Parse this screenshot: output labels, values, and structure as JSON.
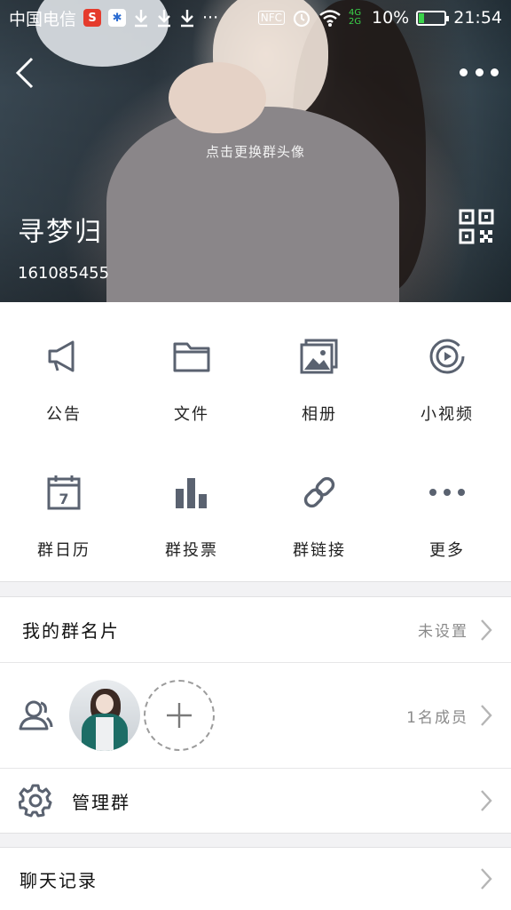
{
  "status_bar": {
    "carrier": "中国电信",
    "app_badge_1": "S",
    "app_badge_2": "✱",
    "download_icons": [
      "download-icon",
      "download-icon",
      "download-icon"
    ],
    "more_dots": "···",
    "nfc": "NFC",
    "network": "4G 2G",
    "battery_percent": "10%",
    "time": "21:54"
  },
  "header": {
    "avatar_hint": "点击更换群头像",
    "group_name": "寻梦归",
    "group_id": "161085455"
  },
  "features": [
    {
      "label": "公告",
      "icon": "megaphone-icon"
    },
    {
      "label": "文件",
      "icon": "folder-icon"
    },
    {
      "label": "相册",
      "icon": "album-icon"
    },
    {
      "label": "小视频",
      "icon": "video-icon"
    },
    {
      "label": "群日历",
      "icon": "calendar-icon"
    },
    {
      "label": "群投票",
      "icon": "poll-icon"
    },
    {
      "label": "群链接",
      "icon": "link-icon"
    },
    {
      "label": "更多",
      "icon": "more-icon"
    }
  ],
  "calendar_day": "7",
  "rows": {
    "my_card": {
      "title": "我的群名片",
      "value": "未设置"
    },
    "members": {
      "value": "1名成员"
    },
    "manage": {
      "title": "管理群"
    },
    "chat_history": {
      "title": "聊天记录"
    }
  },
  "colors": {
    "icon_gray": "#5a6270",
    "separator": "#f2f2f4",
    "battery_green": "#3bd34a"
  }
}
